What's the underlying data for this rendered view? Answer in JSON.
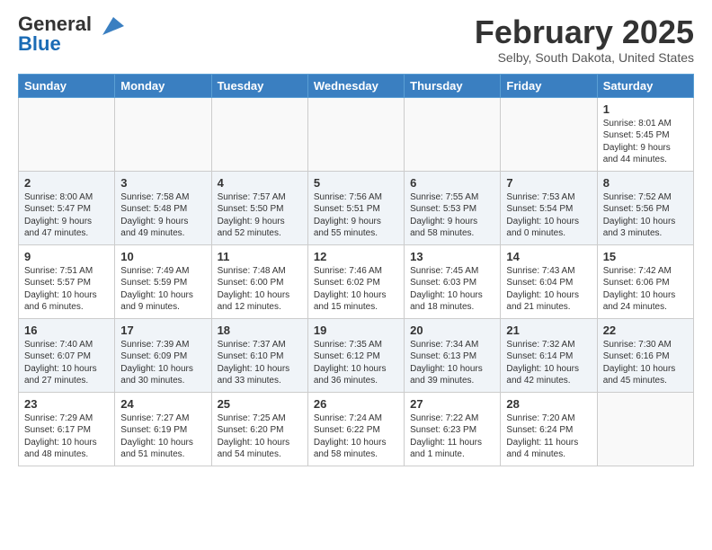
{
  "header": {
    "logo_general": "General",
    "logo_blue": "Blue",
    "month": "February 2025",
    "location": "Selby, South Dakota, United States"
  },
  "weekdays": [
    "Sunday",
    "Monday",
    "Tuesday",
    "Wednesday",
    "Thursday",
    "Friday",
    "Saturday"
  ],
  "weeks": [
    [
      {
        "day": "",
        "info": ""
      },
      {
        "day": "",
        "info": ""
      },
      {
        "day": "",
        "info": ""
      },
      {
        "day": "",
        "info": ""
      },
      {
        "day": "",
        "info": ""
      },
      {
        "day": "",
        "info": ""
      },
      {
        "day": "1",
        "info": "Sunrise: 8:01 AM\nSunset: 5:45 PM\nDaylight: 9 hours\nand 44 minutes."
      }
    ],
    [
      {
        "day": "2",
        "info": "Sunrise: 8:00 AM\nSunset: 5:47 PM\nDaylight: 9 hours\nand 47 minutes."
      },
      {
        "day": "3",
        "info": "Sunrise: 7:58 AM\nSunset: 5:48 PM\nDaylight: 9 hours\nand 49 minutes."
      },
      {
        "day": "4",
        "info": "Sunrise: 7:57 AM\nSunset: 5:50 PM\nDaylight: 9 hours\nand 52 minutes."
      },
      {
        "day": "5",
        "info": "Sunrise: 7:56 AM\nSunset: 5:51 PM\nDaylight: 9 hours\nand 55 minutes."
      },
      {
        "day": "6",
        "info": "Sunrise: 7:55 AM\nSunset: 5:53 PM\nDaylight: 9 hours\nand 58 minutes."
      },
      {
        "day": "7",
        "info": "Sunrise: 7:53 AM\nSunset: 5:54 PM\nDaylight: 10 hours\nand 0 minutes."
      },
      {
        "day": "8",
        "info": "Sunrise: 7:52 AM\nSunset: 5:56 PM\nDaylight: 10 hours\nand 3 minutes."
      }
    ],
    [
      {
        "day": "9",
        "info": "Sunrise: 7:51 AM\nSunset: 5:57 PM\nDaylight: 10 hours\nand 6 minutes."
      },
      {
        "day": "10",
        "info": "Sunrise: 7:49 AM\nSunset: 5:59 PM\nDaylight: 10 hours\nand 9 minutes."
      },
      {
        "day": "11",
        "info": "Sunrise: 7:48 AM\nSunset: 6:00 PM\nDaylight: 10 hours\nand 12 minutes."
      },
      {
        "day": "12",
        "info": "Sunrise: 7:46 AM\nSunset: 6:02 PM\nDaylight: 10 hours\nand 15 minutes."
      },
      {
        "day": "13",
        "info": "Sunrise: 7:45 AM\nSunset: 6:03 PM\nDaylight: 10 hours\nand 18 minutes."
      },
      {
        "day": "14",
        "info": "Sunrise: 7:43 AM\nSunset: 6:04 PM\nDaylight: 10 hours\nand 21 minutes."
      },
      {
        "day": "15",
        "info": "Sunrise: 7:42 AM\nSunset: 6:06 PM\nDaylight: 10 hours\nand 24 minutes."
      }
    ],
    [
      {
        "day": "16",
        "info": "Sunrise: 7:40 AM\nSunset: 6:07 PM\nDaylight: 10 hours\nand 27 minutes."
      },
      {
        "day": "17",
        "info": "Sunrise: 7:39 AM\nSunset: 6:09 PM\nDaylight: 10 hours\nand 30 minutes."
      },
      {
        "day": "18",
        "info": "Sunrise: 7:37 AM\nSunset: 6:10 PM\nDaylight: 10 hours\nand 33 minutes."
      },
      {
        "day": "19",
        "info": "Sunrise: 7:35 AM\nSunset: 6:12 PM\nDaylight: 10 hours\nand 36 minutes."
      },
      {
        "day": "20",
        "info": "Sunrise: 7:34 AM\nSunset: 6:13 PM\nDaylight: 10 hours\nand 39 minutes."
      },
      {
        "day": "21",
        "info": "Sunrise: 7:32 AM\nSunset: 6:14 PM\nDaylight: 10 hours\nand 42 minutes."
      },
      {
        "day": "22",
        "info": "Sunrise: 7:30 AM\nSunset: 6:16 PM\nDaylight: 10 hours\nand 45 minutes."
      }
    ],
    [
      {
        "day": "23",
        "info": "Sunrise: 7:29 AM\nSunset: 6:17 PM\nDaylight: 10 hours\nand 48 minutes."
      },
      {
        "day": "24",
        "info": "Sunrise: 7:27 AM\nSunset: 6:19 PM\nDaylight: 10 hours\nand 51 minutes."
      },
      {
        "day": "25",
        "info": "Sunrise: 7:25 AM\nSunset: 6:20 PM\nDaylight: 10 hours\nand 54 minutes."
      },
      {
        "day": "26",
        "info": "Sunrise: 7:24 AM\nSunset: 6:22 PM\nDaylight: 10 hours\nand 58 minutes."
      },
      {
        "day": "27",
        "info": "Sunrise: 7:22 AM\nSunset: 6:23 PM\nDaylight: 11 hours\nand 1 minute."
      },
      {
        "day": "28",
        "info": "Sunrise: 7:20 AM\nSunset: 6:24 PM\nDaylight: 11 hours\nand 4 minutes."
      },
      {
        "day": "",
        "info": ""
      }
    ]
  ]
}
